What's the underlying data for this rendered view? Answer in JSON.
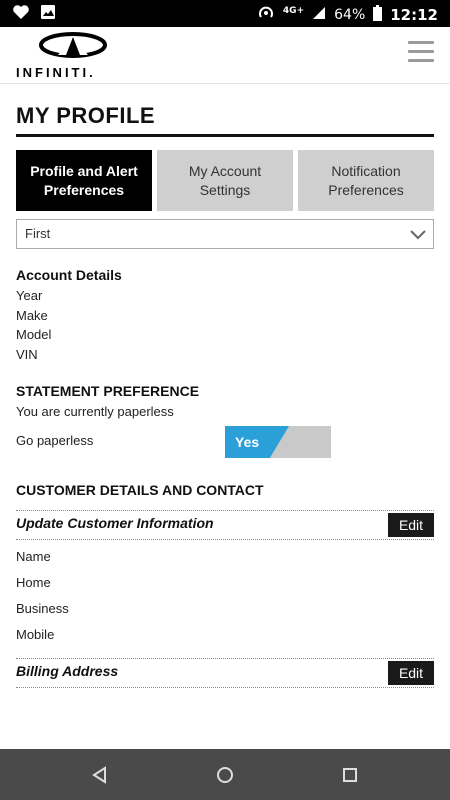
{
  "status_bar": {
    "icons_left": [
      "heart-icon",
      "image-icon"
    ],
    "network": "4G+",
    "battery_percent": "64%",
    "time": "12:12"
  },
  "header": {
    "logo_text": "INFINITI.",
    "menu_icon": "hamburger-icon"
  },
  "page": {
    "title": "MY PROFILE"
  },
  "tabs": [
    {
      "label": "Profile and Alert Preferences",
      "active": true
    },
    {
      "label": "My Account Settings",
      "active": false
    },
    {
      "label": "Notification Preferences",
      "active": false
    }
  ],
  "vehicle_select": {
    "value": "First"
  },
  "account_details": {
    "heading": "Account Details",
    "fields": [
      "Year",
      "Make",
      "Model",
      "VIN"
    ]
  },
  "statement_preference": {
    "heading": "STATEMENT PREFERENCE",
    "status": "You are currently paperless",
    "toggle_label": "Go paperless",
    "toggle_value": "Yes"
  },
  "customer_details": {
    "heading": "CUSTOMER DETAILS AND CONTACT",
    "update_label": "Update Customer Information",
    "edit_label": "Edit",
    "fields": [
      "Name",
      "Home",
      "Business",
      "Mobile"
    ],
    "billing_label": "Billing Address",
    "billing_edit_label": "Edit"
  },
  "colors": {
    "toggle_on": "#2b9fd8",
    "tab_active": "#000000",
    "tab_inactive": "#cfcfcf"
  }
}
